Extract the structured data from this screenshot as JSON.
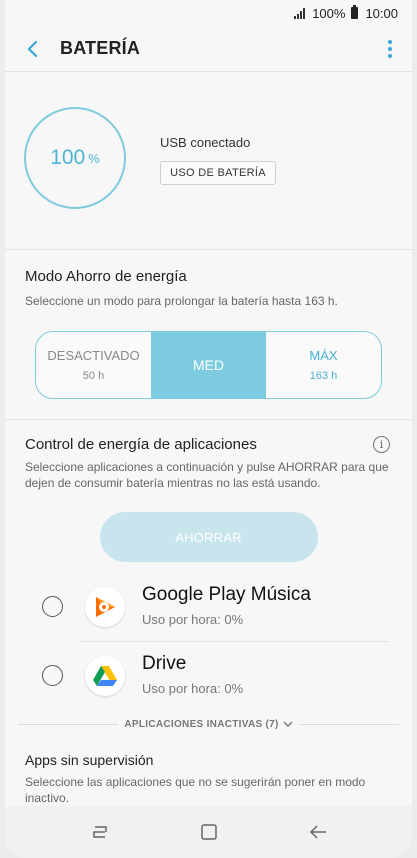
{
  "status_bar": {
    "battery_text": "100%",
    "time": "10:00"
  },
  "app_bar": {
    "title": "BATERÍA",
    "back_icon": "back-arrow-icon",
    "menu_icon": "more-vertical-icon"
  },
  "battery": {
    "percent": "100",
    "percent_symbol": "%",
    "connection_status": "USB conectado",
    "usage_button": "USO DE BATERÍA",
    "accent_color": "#7ecbe0"
  },
  "power_mode": {
    "title": "Modo Ahorro de energía",
    "subtitle": "Seleccione un modo para prolongar la batería hasta 163 h.",
    "options": [
      {
        "label": "DESACTIVADO",
        "value": "50 h",
        "active": false
      },
      {
        "label": "MED",
        "value": "",
        "active": true
      },
      {
        "label": "MÁX",
        "value": "163 h",
        "active": false
      }
    ],
    "active_color": "#7ccbe1"
  },
  "app_power": {
    "title": "Control de energía de aplicaciones",
    "description": "Seleccione aplicaciones a continuación y pulse AHORRAR para que dejen de consumir batería mientras no las está usando.",
    "save_button": "AHORRAR",
    "apps": [
      {
        "name": "Google Play Música",
        "usage": "Uso por hora: 0%",
        "icon": "google-play-music-icon"
      },
      {
        "name": "Drive",
        "usage": "Uso por hora: 0%",
        "icon": "google-drive-icon"
      }
    ],
    "inactive_label": "APLICACIONES INACTIVAS (7)"
  },
  "unsupervised": {
    "title": "Apps sin supervisión",
    "description": "Seleccione las aplicaciones que no se sugerirán poner en modo inactivo."
  },
  "nav_bar": {
    "buttons": [
      "recents-icon",
      "home-icon",
      "back-icon"
    ]
  }
}
